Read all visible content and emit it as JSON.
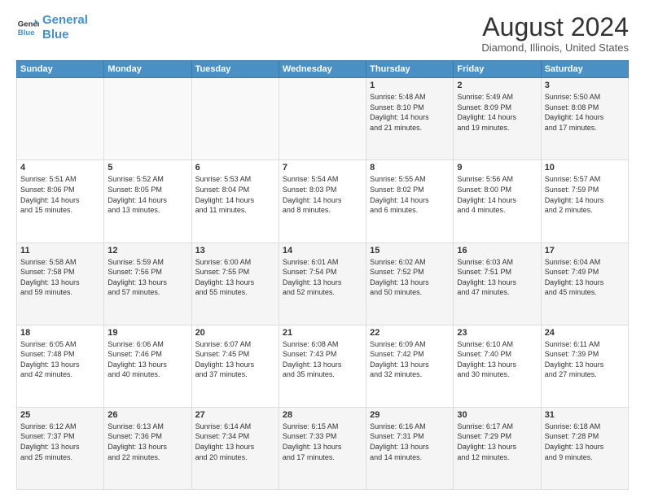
{
  "header": {
    "logo_line1": "General",
    "logo_line2": "Blue",
    "title": "August 2024",
    "subtitle": "Diamond, Illinois, United States"
  },
  "calendar": {
    "days_of_week": [
      "Sunday",
      "Monday",
      "Tuesday",
      "Wednesday",
      "Thursday",
      "Friday",
      "Saturday"
    ],
    "weeks": [
      [
        {
          "day": "",
          "info": ""
        },
        {
          "day": "",
          "info": ""
        },
        {
          "day": "",
          "info": ""
        },
        {
          "day": "",
          "info": ""
        },
        {
          "day": "1",
          "info": "Sunrise: 5:48 AM\nSunset: 8:10 PM\nDaylight: 14 hours\nand 21 minutes."
        },
        {
          "day": "2",
          "info": "Sunrise: 5:49 AM\nSunset: 8:09 PM\nDaylight: 14 hours\nand 19 minutes."
        },
        {
          "day": "3",
          "info": "Sunrise: 5:50 AM\nSunset: 8:08 PM\nDaylight: 14 hours\nand 17 minutes."
        }
      ],
      [
        {
          "day": "4",
          "info": "Sunrise: 5:51 AM\nSunset: 8:06 PM\nDaylight: 14 hours\nand 15 minutes."
        },
        {
          "day": "5",
          "info": "Sunrise: 5:52 AM\nSunset: 8:05 PM\nDaylight: 14 hours\nand 13 minutes."
        },
        {
          "day": "6",
          "info": "Sunrise: 5:53 AM\nSunset: 8:04 PM\nDaylight: 14 hours\nand 11 minutes."
        },
        {
          "day": "7",
          "info": "Sunrise: 5:54 AM\nSunset: 8:03 PM\nDaylight: 14 hours\nand 8 minutes."
        },
        {
          "day": "8",
          "info": "Sunrise: 5:55 AM\nSunset: 8:02 PM\nDaylight: 14 hours\nand 6 minutes."
        },
        {
          "day": "9",
          "info": "Sunrise: 5:56 AM\nSunset: 8:00 PM\nDaylight: 14 hours\nand 4 minutes."
        },
        {
          "day": "10",
          "info": "Sunrise: 5:57 AM\nSunset: 7:59 PM\nDaylight: 14 hours\nand 2 minutes."
        }
      ],
      [
        {
          "day": "11",
          "info": "Sunrise: 5:58 AM\nSunset: 7:58 PM\nDaylight: 13 hours\nand 59 minutes."
        },
        {
          "day": "12",
          "info": "Sunrise: 5:59 AM\nSunset: 7:56 PM\nDaylight: 13 hours\nand 57 minutes."
        },
        {
          "day": "13",
          "info": "Sunrise: 6:00 AM\nSunset: 7:55 PM\nDaylight: 13 hours\nand 55 minutes."
        },
        {
          "day": "14",
          "info": "Sunrise: 6:01 AM\nSunset: 7:54 PM\nDaylight: 13 hours\nand 52 minutes."
        },
        {
          "day": "15",
          "info": "Sunrise: 6:02 AM\nSunset: 7:52 PM\nDaylight: 13 hours\nand 50 minutes."
        },
        {
          "day": "16",
          "info": "Sunrise: 6:03 AM\nSunset: 7:51 PM\nDaylight: 13 hours\nand 47 minutes."
        },
        {
          "day": "17",
          "info": "Sunrise: 6:04 AM\nSunset: 7:49 PM\nDaylight: 13 hours\nand 45 minutes."
        }
      ],
      [
        {
          "day": "18",
          "info": "Sunrise: 6:05 AM\nSunset: 7:48 PM\nDaylight: 13 hours\nand 42 minutes."
        },
        {
          "day": "19",
          "info": "Sunrise: 6:06 AM\nSunset: 7:46 PM\nDaylight: 13 hours\nand 40 minutes."
        },
        {
          "day": "20",
          "info": "Sunrise: 6:07 AM\nSunset: 7:45 PM\nDaylight: 13 hours\nand 37 minutes."
        },
        {
          "day": "21",
          "info": "Sunrise: 6:08 AM\nSunset: 7:43 PM\nDaylight: 13 hours\nand 35 minutes."
        },
        {
          "day": "22",
          "info": "Sunrise: 6:09 AM\nSunset: 7:42 PM\nDaylight: 13 hours\nand 32 minutes."
        },
        {
          "day": "23",
          "info": "Sunrise: 6:10 AM\nSunset: 7:40 PM\nDaylight: 13 hours\nand 30 minutes."
        },
        {
          "day": "24",
          "info": "Sunrise: 6:11 AM\nSunset: 7:39 PM\nDaylight: 13 hours\nand 27 minutes."
        }
      ],
      [
        {
          "day": "25",
          "info": "Sunrise: 6:12 AM\nSunset: 7:37 PM\nDaylight: 13 hours\nand 25 minutes."
        },
        {
          "day": "26",
          "info": "Sunrise: 6:13 AM\nSunset: 7:36 PM\nDaylight: 13 hours\nand 22 minutes."
        },
        {
          "day": "27",
          "info": "Sunrise: 6:14 AM\nSunset: 7:34 PM\nDaylight: 13 hours\nand 20 minutes."
        },
        {
          "day": "28",
          "info": "Sunrise: 6:15 AM\nSunset: 7:33 PM\nDaylight: 13 hours\nand 17 minutes."
        },
        {
          "day": "29",
          "info": "Sunrise: 6:16 AM\nSunset: 7:31 PM\nDaylight: 13 hours\nand 14 minutes."
        },
        {
          "day": "30",
          "info": "Sunrise: 6:17 AM\nSunset: 7:29 PM\nDaylight: 13 hours\nand 12 minutes."
        },
        {
          "day": "31",
          "info": "Sunrise: 6:18 AM\nSunset: 7:28 PM\nDaylight: 13 hours\nand 9 minutes."
        }
      ]
    ]
  }
}
